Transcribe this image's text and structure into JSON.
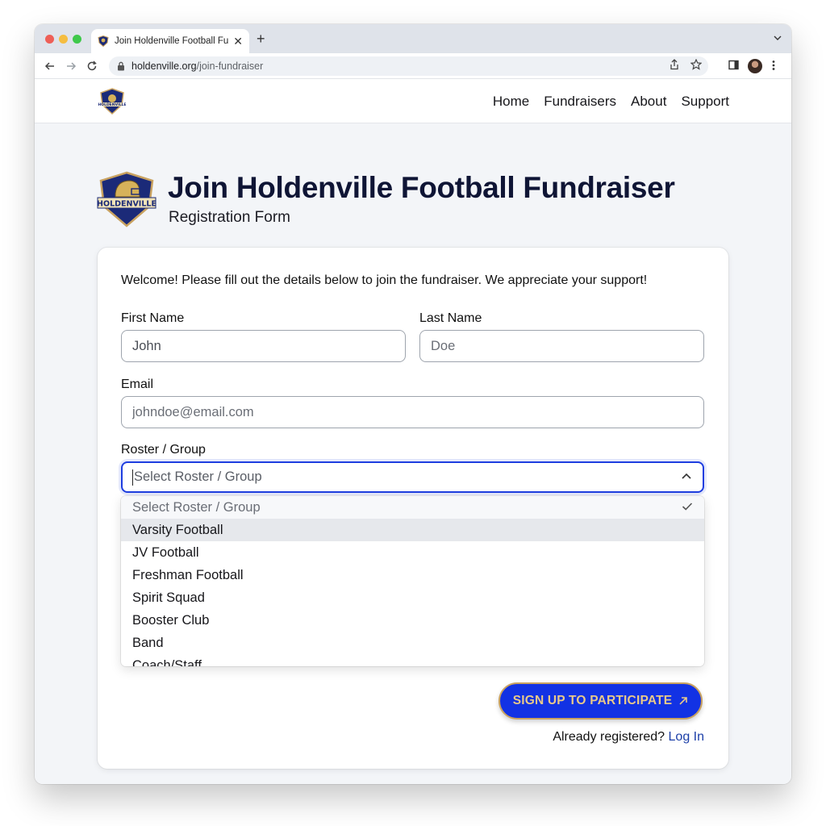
{
  "browser": {
    "tab_title": "Join Holdenville Football Fund",
    "url_domain": "holdenville.org",
    "url_path": "/join-fundraiser"
  },
  "site": {
    "logo_text": "HOLDENVILLE",
    "nav": [
      "Home",
      "Fundraisers",
      "About",
      "Support"
    ]
  },
  "header": {
    "title": "Join Holdenville Football Fundraiser",
    "subtitle": "Registration Form"
  },
  "form": {
    "welcome": "Welcome! Please fill out the details below to join the fundraiser. We appreciate your support!",
    "first_name": {
      "label": "First Name",
      "value": "John"
    },
    "last_name": {
      "label": "Last Name",
      "placeholder": "Doe"
    },
    "email": {
      "label": "Email",
      "placeholder": "johndoe@email.com"
    },
    "roster": {
      "label": "Roster / Group",
      "placeholder": "Select Roster / Group",
      "options": [
        "Select Roster / Group",
        "Varsity Football",
        "JV Football",
        "Freshman Football",
        "Spirit Squad",
        "Booster Club",
        "Band",
        "Coach/Staff"
      ]
    },
    "submit_label": "SIGN UP TO PARTICIPATE",
    "already_text": "Already registered?",
    "login_label": "Log In"
  },
  "colors": {
    "accent": "#1232e4",
    "gold": "#c9a260",
    "title": "#0f1535",
    "link": "#1c3fa8"
  }
}
